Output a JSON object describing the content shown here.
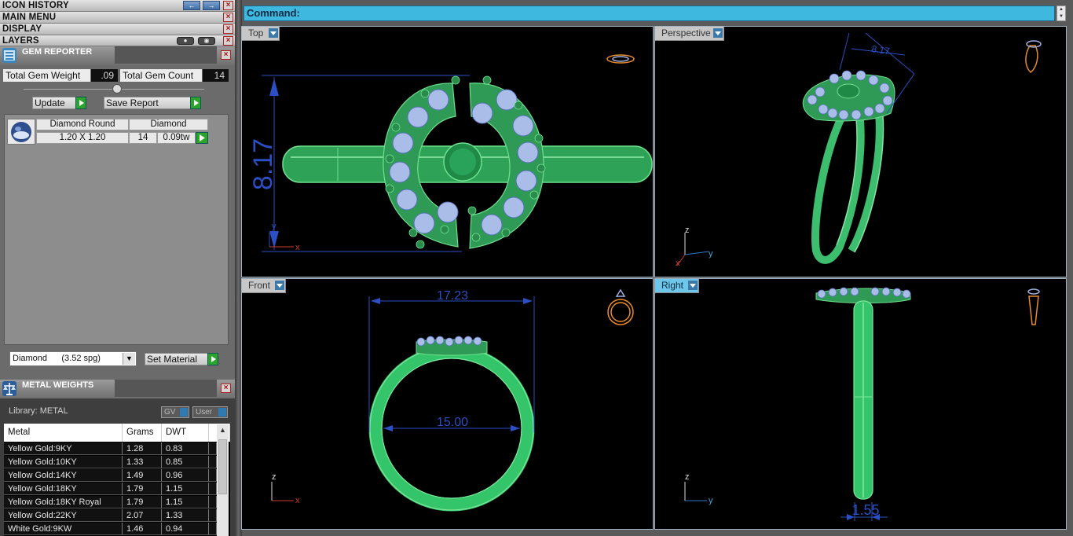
{
  "menus": {
    "icon_history": "ICON HISTORY",
    "main_menu": "MAIN MENU",
    "display": "DISPLAY",
    "layers": "LAYERS"
  },
  "gem_reporter": {
    "title": "GEM REPORTER",
    "total_gem_weight_label": "Total Gem Weight",
    "total_gem_weight": ".09",
    "total_gem_count_label": "Total Gem Count",
    "total_gem_count": "14",
    "update_label": "Update",
    "save_report_label": "Save Report",
    "gems": [
      {
        "name": "Diamond Round",
        "type": "Diamond",
        "size": "1.20 X 1.20",
        "count": "14",
        "weight": "0.09tw"
      }
    ],
    "material_select": "Diamond      (3.52 spg)",
    "set_material_label": "Set Material"
  },
  "metal_weights": {
    "title": "METAL WEIGHTS",
    "library": "Library: METAL",
    "toggle_gv": "GV",
    "toggle_user": "User",
    "columns": [
      "Metal",
      "Grams",
      "DWT"
    ],
    "rows": [
      [
        "Yellow Gold:9KY",
        "1.28",
        "0.83"
      ],
      [
        "Yellow Gold:10KY",
        "1.33",
        "0.85"
      ],
      [
        "Yellow Gold:14KY",
        "1.49",
        "0.96"
      ],
      [
        "Yellow Gold:18KY",
        "1.79",
        "1.15"
      ],
      [
        "Yellow Gold:18KY Royal",
        "1.79",
        "1.15"
      ],
      [
        "Yellow Gold:22KY",
        "2.07",
        "1.33"
      ],
      [
        "White Gold:9KW",
        "1.46",
        "0.94"
      ]
    ]
  },
  "command": {
    "label": "Command:"
  },
  "viewports": {
    "top": {
      "label": "Top",
      "dim": "8.17",
      "axis_v": "y",
      "axis_h": "x"
    },
    "perspective": {
      "label": "Perspective",
      "dim": "8.17",
      "axis_v": "z",
      "axis_h": "y",
      "axis_d": "x"
    },
    "front": {
      "label": "Front",
      "dim_outer": "17.23",
      "dim_inner": "15.00",
      "axis_v": "z",
      "axis_h": "x"
    },
    "right": {
      "label": "Right",
      "dim": "1.55",
      "axis_v": "z",
      "axis_h": "y"
    }
  },
  "colors": {
    "metal": "#34c46a",
    "gem": "#b7c8ee",
    "dimension": "#2b4fc4",
    "command_bar": "#3fb8e0"
  }
}
